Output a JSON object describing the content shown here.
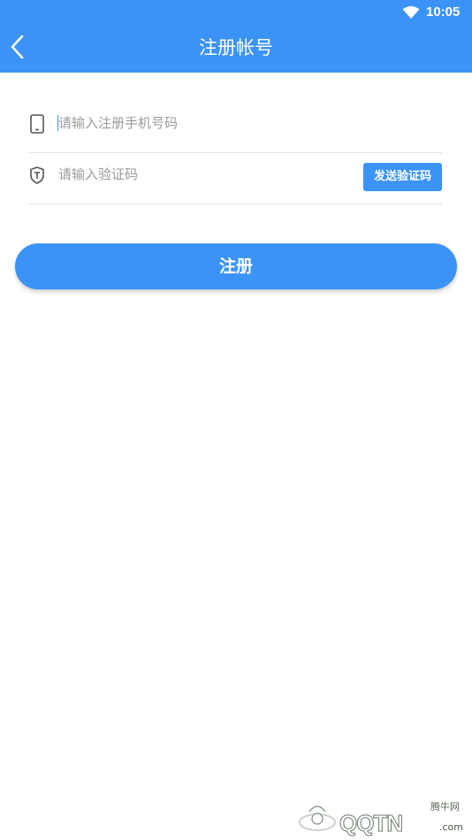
{
  "status_bar": {
    "time": "10:05",
    "wifi_icon": "wifi-icon"
  },
  "header": {
    "title": "注册帐号",
    "back_icon": "chevron-left-icon"
  },
  "form": {
    "phone": {
      "icon": "phone-icon",
      "placeholder": "请输入注册手机号码",
      "value": ""
    },
    "code": {
      "icon": "shield-icon",
      "placeholder": "请输入验证码",
      "value": "",
      "send_button_label": "发送验证码"
    },
    "register_button_label": "注册"
  },
  "watermark": {
    "cn_text": "腾牛网",
    "brand": "QQTN",
    "domain": ".com"
  },
  "colors": {
    "accent": "#3b93f7",
    "divider": "#e3e3e3",
    "placeholder": "#9a9a9a"
  }
}
